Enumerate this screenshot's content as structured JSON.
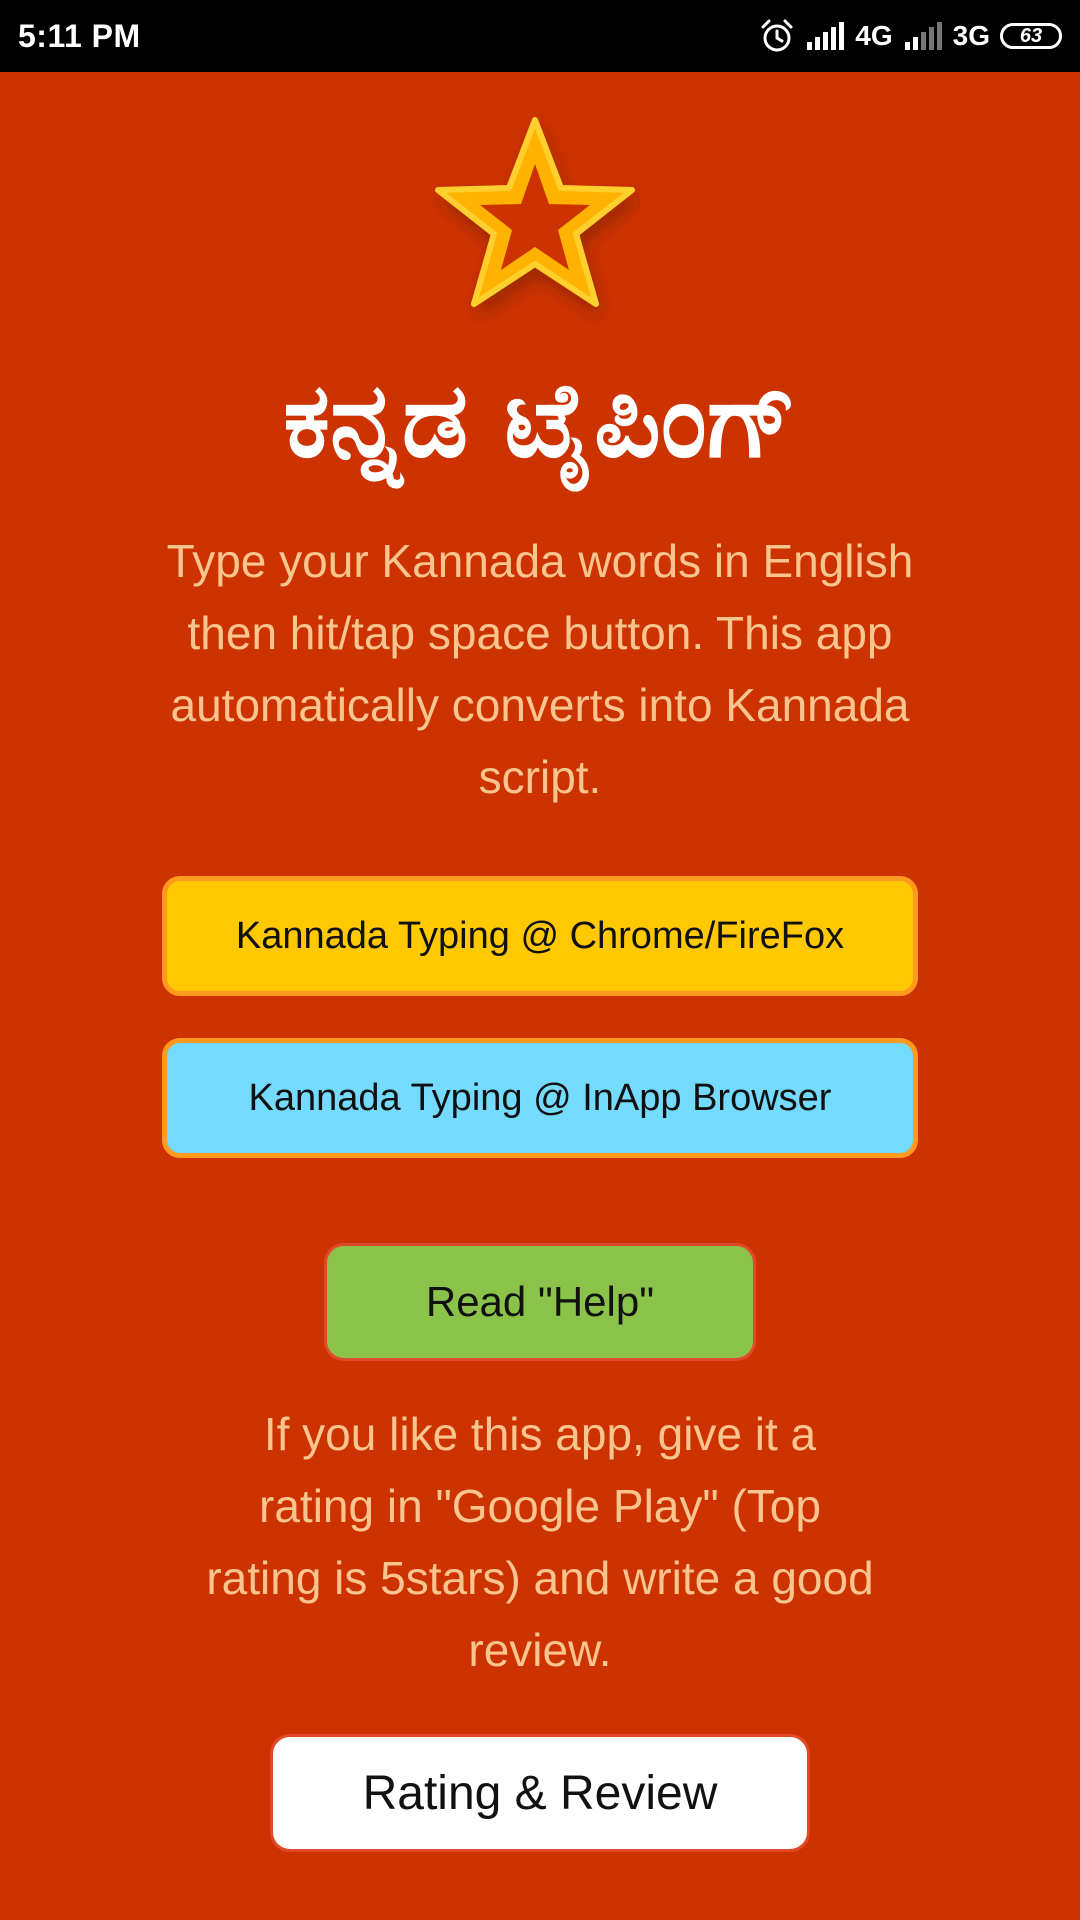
{
  "status_bar": {
    "time": "5:11 PM",
    "network_1": "4G",
    "network_2": "3G",
    "battery": "63",
    "icons": [
      "alarm-icon",
      "signal-icon",
      "signal-icon",
      "battery-icon"
    ]
  },
  "app": {
    "logo_icon": "star-icon",
    "title": "ಕನ್ನಡ ಟೈಪಿಂಗ್",
    "description": "Type your Kannada words in English then hit/tap space button. This app automatically converts into Kannada script.",
    "rating_prompt": "If you like this app, give it a rating in \"Google Play\" (Top rating is 5stars) and write a good review."
  },
  "buttons": {
    "chrome": "Kannada Typing @ Chrome/FireFox",
    "inapp": "Kannada Typing @ InApp Browser",
    "help": "Read \"Help\"",
    "rating": "Rating & Review"
  },
  "colors": {
    "background": "#CC3300",
    "status_bar": "#000000",
    "text_light": "#F9C48E",
    "chrome_button": "#FFC800",
    "inapp_button": "#74DBFF",
    "help_button": "#8BC34A",
    "rating_button": "#FFFFFF",
    "button_border": "#FF9A1E",
    "star_fill": "#FFB300"
  }
}
